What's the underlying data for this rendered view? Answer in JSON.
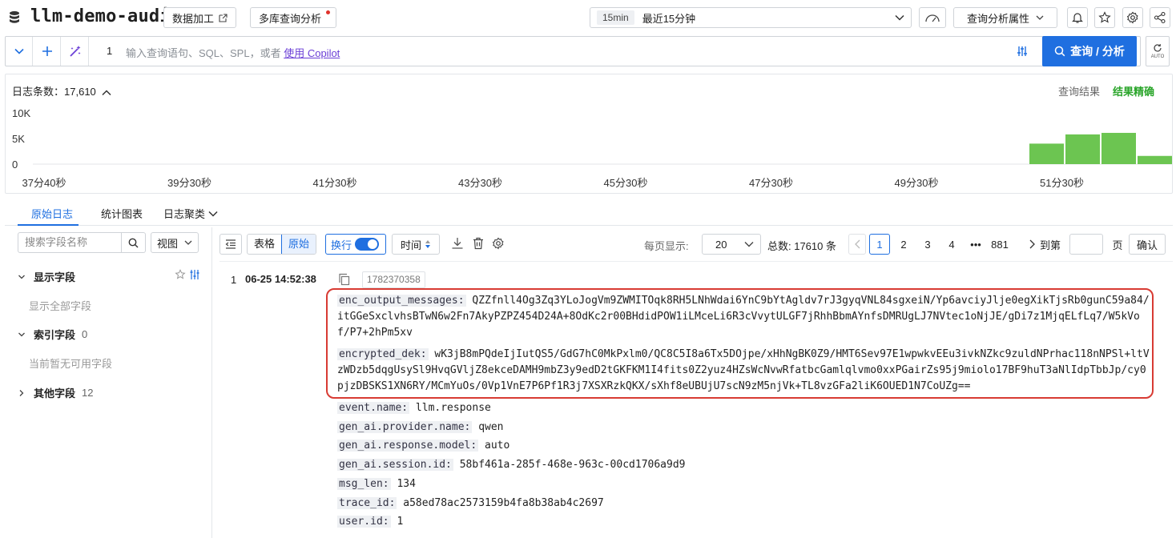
{
  "header": {
    "title": "llm-demo-audit",
    "btn_data_process": "数据加工",
    "btn_multi_query": "多库查询分析",
    "time_chip": "15min",
    "time_label": "最近15分钟",
    "query_props": "查询分析属性"
  },
  "query": {
    "line_no": "1",
    "placeholder": "输入查询语句、SQL、SPL，或者",
    "copilot_link": "使用 Copilot",
    "submit_label": "查询 / 分析",
    "auto_label": "AUTO"
  },
  "histogram": {
    "count_label": "日志条数：",
    "count_value": "17,610",
    "query_result": "查询结果",
    "precise": "结果精确",
    "bar_color": "#6cc551"
  },
  "chart_data": {
    "type": "bar",
    "x_tick_labels": [
      "37分40秒",
      "39分30秒",
      "41分30秒",
      "43分30秒",
      "45分30秒",
      "47分30秒",
      "49分30秒",
      "51分30秒"
    ],
    "y_tick_labels": [
      "10K",
      "5K",
      "0"
    ],
    "ylim": [
      0,
      10000
    ],
    "bars": [
      {
        "label": "bucket-1",
        "value": 4000
      },
      {
        "label": "bucket-2",
        "value": 5800
      },
      {
        "label": "bucket-3",
        "value": 6100
      },
      {
        "label": "bucket-4",
        "value": 1600
      }
    ]
  },
  "tabs": [
    "原始日志",
    "统计图表",
    "日志聚类"
  ],
  "fields_panel": {
    "search_placeholder": "搜索字段名称",
    "view_label": "视图",
    "shown_fields": "显示字段",
    "show_all": "显示全部字段",
    "index_fields": "索引字段",
    "index_count": "0",
    "no_fields": "当前暂无可用字段",
    "other_fields": "其他字段",
    "other_count": "12"
  },
  "toolbar": {
    "table_label": "表格",
    "raw_label": "原始",
    "wrap_label": "换行",
    "time_label": "时间",
    "per_page_label": "每页显示:",
    "per_page_value": "20",
    "total_label": "总数: 17610 条",
    "pages": [
      "1",
      "2",
      "3",
      "4",
      "•••",
      "881"
    ],
    "goto_label": "到第",
    "page_unit": "页",
    "confirm_label": "确认"
  },
  "entry": {
    "index": "1",
    "time": "06-25 14:52:38",
    "id": "1782370358",
    "fields": [
      {
        "key": "enc_output_messages:",
        "value": "QZZfnll4Og3Zq3YLoJogVm9ZWMITOqk8RH5LNhWdai6YnC9bYtAgldv7rJ3gyqVNL84sgxeiN/Yp6avciyJlje0egXikTjsRb0gunC59a84/itGGeSxclvhsBTwN6w2Fn7AkyPZPZ454D24A+8OdKc2r00BHdidPOW1iLMceLi6R3cVvytULGF7jRhhBbmAYnfsDMRUgLJ7NVtec1oNjJE/gDi7z1MjqELfLq7/W5kVof/P7+2hPm5xv"
      },
      {
        "key": "encrypted_dek:",
        "value": "wK3jB8mPQdeIjIutQS5/GdG7hC0MkPxlm0/QC8C5I8a6Tx5DOjpe/xHhNgBK0Z9/HMT6Sev97E1wpwkvEEu3ivkNZkc9zuldNPrhac118nNPSl+ltVzWDzb5dqgUsySl9HvqGVljZ8ekceDAMH9mbZ3y9edD2tGKFKM1I4fits0Z2yuz4HZsWcNvwRfatbcGamlqlvmo0xxPGairZs95j9miolo17BF9huT3aNlIdpTbbJp/cy0pjzDBSKS1XN6RY/MCmYuOs/0Vp1VnE7P6Pf1R3j7XSXRzkQKX/sXhf8eUBUjU7scN9zM5njVk+TL8vzGFa2liK6OUED1N7CoUZg=="
      },
      {
        "key": "event.name:",
        "value": "llm.response"
      },
      {
        "key": "gen_ai.provider.name:",
        "value": "qwen"
      },
      {
        "key": "gen_ai.response.model:",
        "value": "auto"
      },
      {
        "key": "gen_ai.session.id:",
        "value": "58bf461a-285f-468e-963c-00cd1706a9d9"
      },
      {
        "key": "msg_len:",
        "value": "134"
      },
      {
        "key": "trace_id:",
        "value": "a58ed78ac2573159b4fa8b38ab4c2697"
      },
      {
        "key": "user.id:",
        "value": "1"
      }
    ]
  }
}
